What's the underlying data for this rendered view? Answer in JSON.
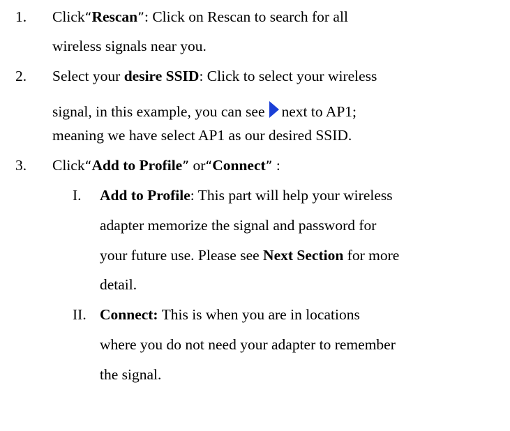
{
  "items": [
    {
      "number": "1.",
      "click": "Click",
      "open_quote": "“",
      "label": "Rescan",
      "close_quote": "”",
      "desc": ": Click on Rescan to search for all",
      "desc2": "wireless signals near you."
    },
    {
      "number": "2.",
      "prefix": "Select your ",
      "label": "desire SSID",
      "desc": ": Click to select your wireless",
      "desc2_a": "signal, in this example, you can see",
      "arrow_icon": "blue-right-triangle-icon",
      "arrow_color": "#1a3fd6",
      "desc2_b": "next to AP1;",
      "desc3": "meaning we have select AP1 as our desired SSID."
    },
    {
      "number": "3.",
      "click": "Click",
      "open_quote1": "“",
      "label1": "Add to Profile",
      "close_quote1": "”",
      "or": " or",
      "open_quote2": "“",
      "label2": "Connect",
      "close_quote2": "”",
      "colon": " :"
    }
  ],
  "subitems": [
    {
      "numeral": "I.",
      "label": "Add to Profile",
      "text1": ": This part will help your wireless",
      "text2": "adapter memorize the signal and password for",
      "text3a": "your future use. Please see ",
      "text3_bold": "Next Section",
      "text3b": " for more",
      "text4": "detail."
    },
    {
      "numeral": "II.",
      "label": "Connect:",
      "text1": " This is when you are in locations",
      "text2": "where you do not need your adapter to remember",
      "text3": "the signal."
    }
  ]
}
